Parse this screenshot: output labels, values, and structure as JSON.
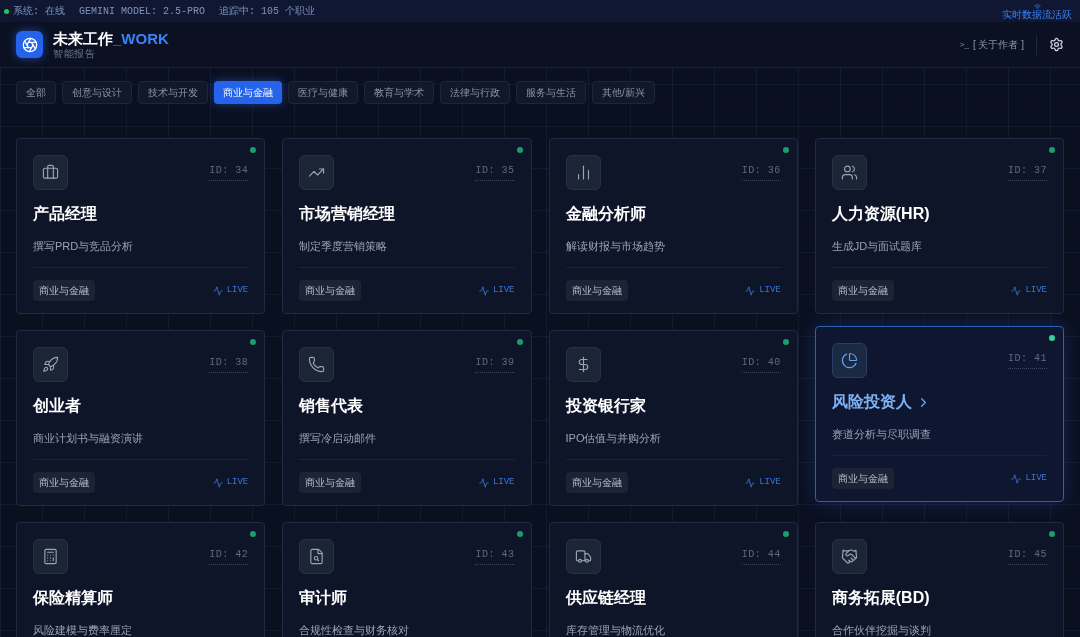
{
  "status_bar": {
    "items": [
      "系统: 在线",
      "GEMINI MODEL: 2.5-PRO",
      "追踪中: 105 个职业"
    ],
    "stream": "实时数据流活跃"
  },
  "header": {
    "title": "未来工作",
    "title_accent": "_WORK",
    "subtitle": "智能报告",
    "about": "[ 关于作者 ]",
    "prompt": ">_"
  },
  "tabs": [
    {
      "label": "全部",
      "selected": false
    },
    {
      "label": "创意与设计",
      "selected": false
    },
    {
      "label": "技术与开发",
      "selected": false
    },
    {
      "label": "商业与金融",
      "selected": true
    },
    {
      "label": "医疗与健康",
      "selected": false
    },
    {
      "label": "教育与学术",
      "selected": false
    },
    {
      "label": "法律与行政",
      "selected": false
    },
    {
      "label": "服务与生活",
      "selected": false
    },
    {
      "label": "其他/新兴",
      "selected": false
    }
  ],
  "cards": [
    {
      "id": "ID: 34",
      "title": "产品经理",
      "desc": "撰写PRD与竞品分析",
      "tag": "商业与金融",
      "live": "LIVE",
      "selected": false
    },
    {
      "id": "ID: 35",
      "title": "市场营销经理",
      "desc": "制定季度营销策略",
      "tag": "商业与金融",
      "live": "LIVE",
      "selected": false
    },
    {
      "id": "ID: 36",
      "title": "金融分析师",
      "desc": "解读财报与市场趋势",
      "tag": "商业与金融",
      "live": "LIVE",
      "selected": false
    },
    {
      "id": "ID: 37",
      "title": "人力资源(HR)",
      "desc": "生成JD与面试题库",
      "tag": "商业与金融",
      "live": "LIVE",
      "selected": false
    },
    {
      "id": "ID: 38",
      "title": "创业者",
      "desc": "商业计划书与融资演讲",
      "tag": "商业与金融",
      "live": "LIVE",
      "selected": false
    },
    {
      "id": "ID: 39",
      "title": "销售代表",
      "desc": "撰写冷启动邮件",
      "tag": "商业与金融",
      "live": "LIVE",
      "selected": false
    },
    {
      "id": "ID: 40",
      "title": "投资银行家",
      "desc": "IPO估值与并购分析",
      "tag": "商业与金融",
      "live": "LIVE",
      "selected": false
    },
    {
      "id": "ID: 41",
      "title": "风险投资人",
      "desc": "赛道分析与尽职调查",
      "tag": "商业与金融",
      "live": "LIVE",
      "selected": true
    },
    {
      "id": "ID: 42",
      "title": "保险精算师",
      "desc": "风险建模与费率厘定",
      "selected": false
    },
    {
      "id": "ID: 43",
      "title": "审计师",
      "desc": "合规性检查与财务核对",
      "selected": false
    },
    {
      "id": "ID: 44",
      "title": "供应链经理",
      "desc": "库存管理与物流优化",
      "selected": false
    },
    {
      "id": "ID: 45",
      "title": "商务拓展(BD)",
      "desc": "合作伙伴挖掘与谈判",
      "selected": false
    }
  ]
}
